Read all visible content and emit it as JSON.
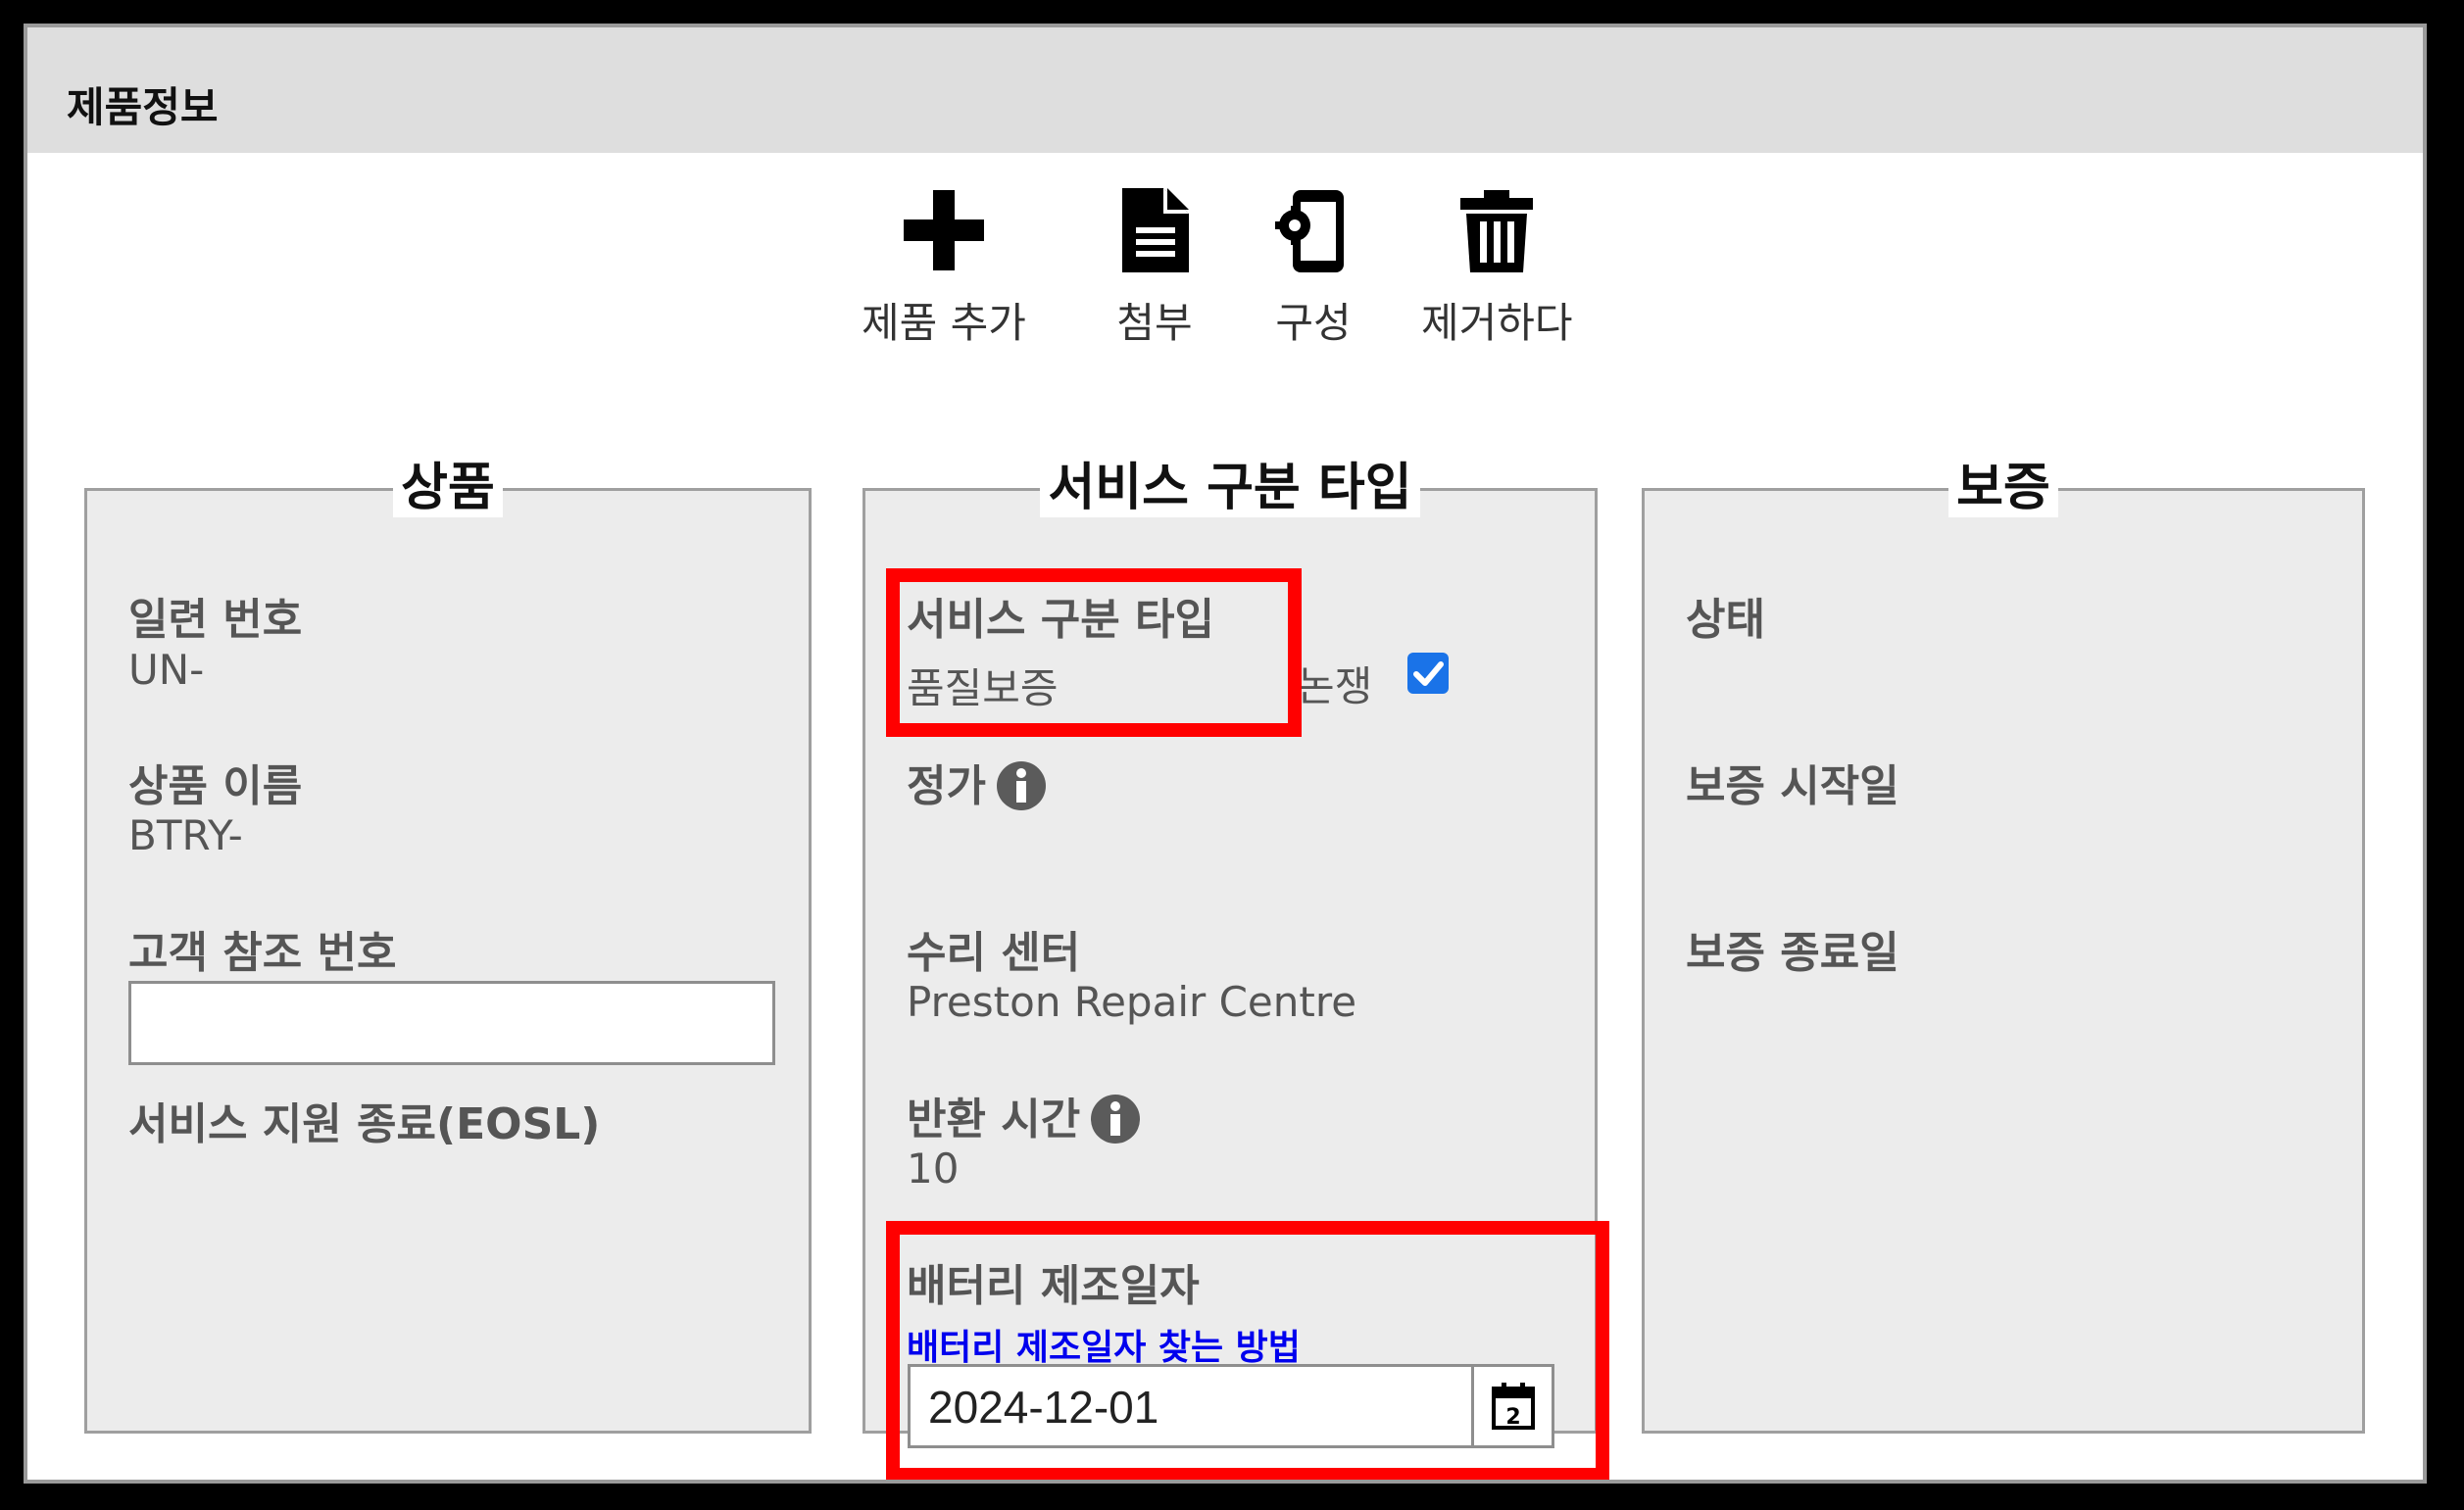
{
  "header": {
    "title": "제품정보"
  },
  "toolbar": {
    "add_label": "제품 추가",
    "attach_label": "첨부",
    "config_label": "구성",
    "remove_label": "제거하다"
  },
  "product_panel": {
    "legend": "상품",
    "serial_label": "일련 번호",
    "serial_value": "UN-",
    "name_label": "상품 이름",
    "name_value": "BTRY-",
    "customer_ref_label": "고객 참조 번호",
    "customer_ref_value": "",
    "eosl_label": "서비스 지원 종료(EOSL)"
  },
  "service_panel": {
    "legend": "서비스 구분 타입",
    "service_type_label": "서비스 구분 타입",
    "service_type_value": "품질보증",
    "dispute_label": "논쟁",
    "dispute_checked": true,
    "list_price_label": "정가",
    "repair_center_label": "수리 센터",
    "repair_center_value": "Preston Repair Centre",
    "turnaround_label": "반환 시간",
    "turnaround_value": "10",
    "battery_date_label": "배터리 제조일자",
    "battery_help_link": "배터리 제조일자 찾는 방법",
    "battery_date_value": "2024-12-01",
    "calendar_icon_digit": "2"
  },
  "warranty_panel": {
    "legend": "보증",
    "status_label": "상태",
    "start_label": "보증 시작일",
    "end_label": "보증 종료일"
  },
  "colors": {
    "highlight": "#ff0000",
    "link": "#0000ee",
    "checkbox": "#1a73e8",
    "panel_bg": "#ececec",
    "header_bg": "#dedede"
  }
}
